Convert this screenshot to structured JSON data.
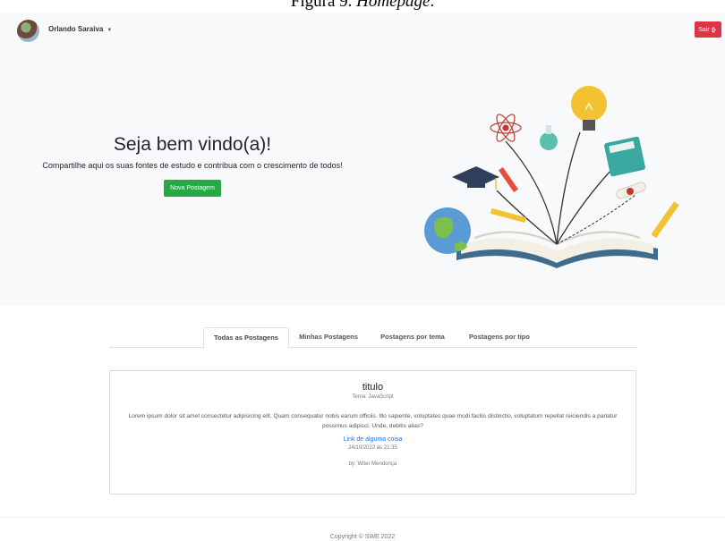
{
  "figure_caption": {
    "prefix": "Figura 9. ",
    "title": "Homepage"
  },
  "navbar": {
    "user_name": "Orlando Saraiva",
    "caret": "▼",
    "logout_label": "Sair",
    "logout_icon": "sign-out-icon"
  },
  "hero": {
    "title": "Seja bem vindo(a)!",
    "subtitle": "Compartilhe aqui os suas fontes de estudo e contribua com o crescimento de todos!",
    "new_post_label": "Nova Postagem",
    "illustration": "open-book-education-illustration"
  },
  "tabs": [
    {
      "label": "Todas as Postagens",
      "active": true
    },
    {
      "label": "Minhas Postagens",
      "active": false
    },
    {
      "label": "Postagens por tema",
      "active": false
    },
    {
      "label": "Postagens por tipo",
      "active": false
    }
  ],
  "post": {
    "title": "titulo",
    "theme": "Tema: JavaScript",
    "body": "Lorem ipsum dolor sit amet consectetur adipisicing elit. Quam consequatur nobis earum officiis. Illo sapiente, voluptates quae modi facilis distinctio, voluptatum repellat reiciendis a pariatur possimus adipisci. Unde, debitis alias?",
    "link": "Link de alguma coisa",
    "date": "24/10/2022 às 21:35",
    "author": "by: Witer Mendonça"
  },
  "footer": {
    "copyright": "Copyright © SWE 2022"
  },
  "colors": {
    "danger": "#dc3545",
    "success": "#28a745",
    "link": "#1a73e8",
    "hero_bg": "#f8f9fa"
  }
}
